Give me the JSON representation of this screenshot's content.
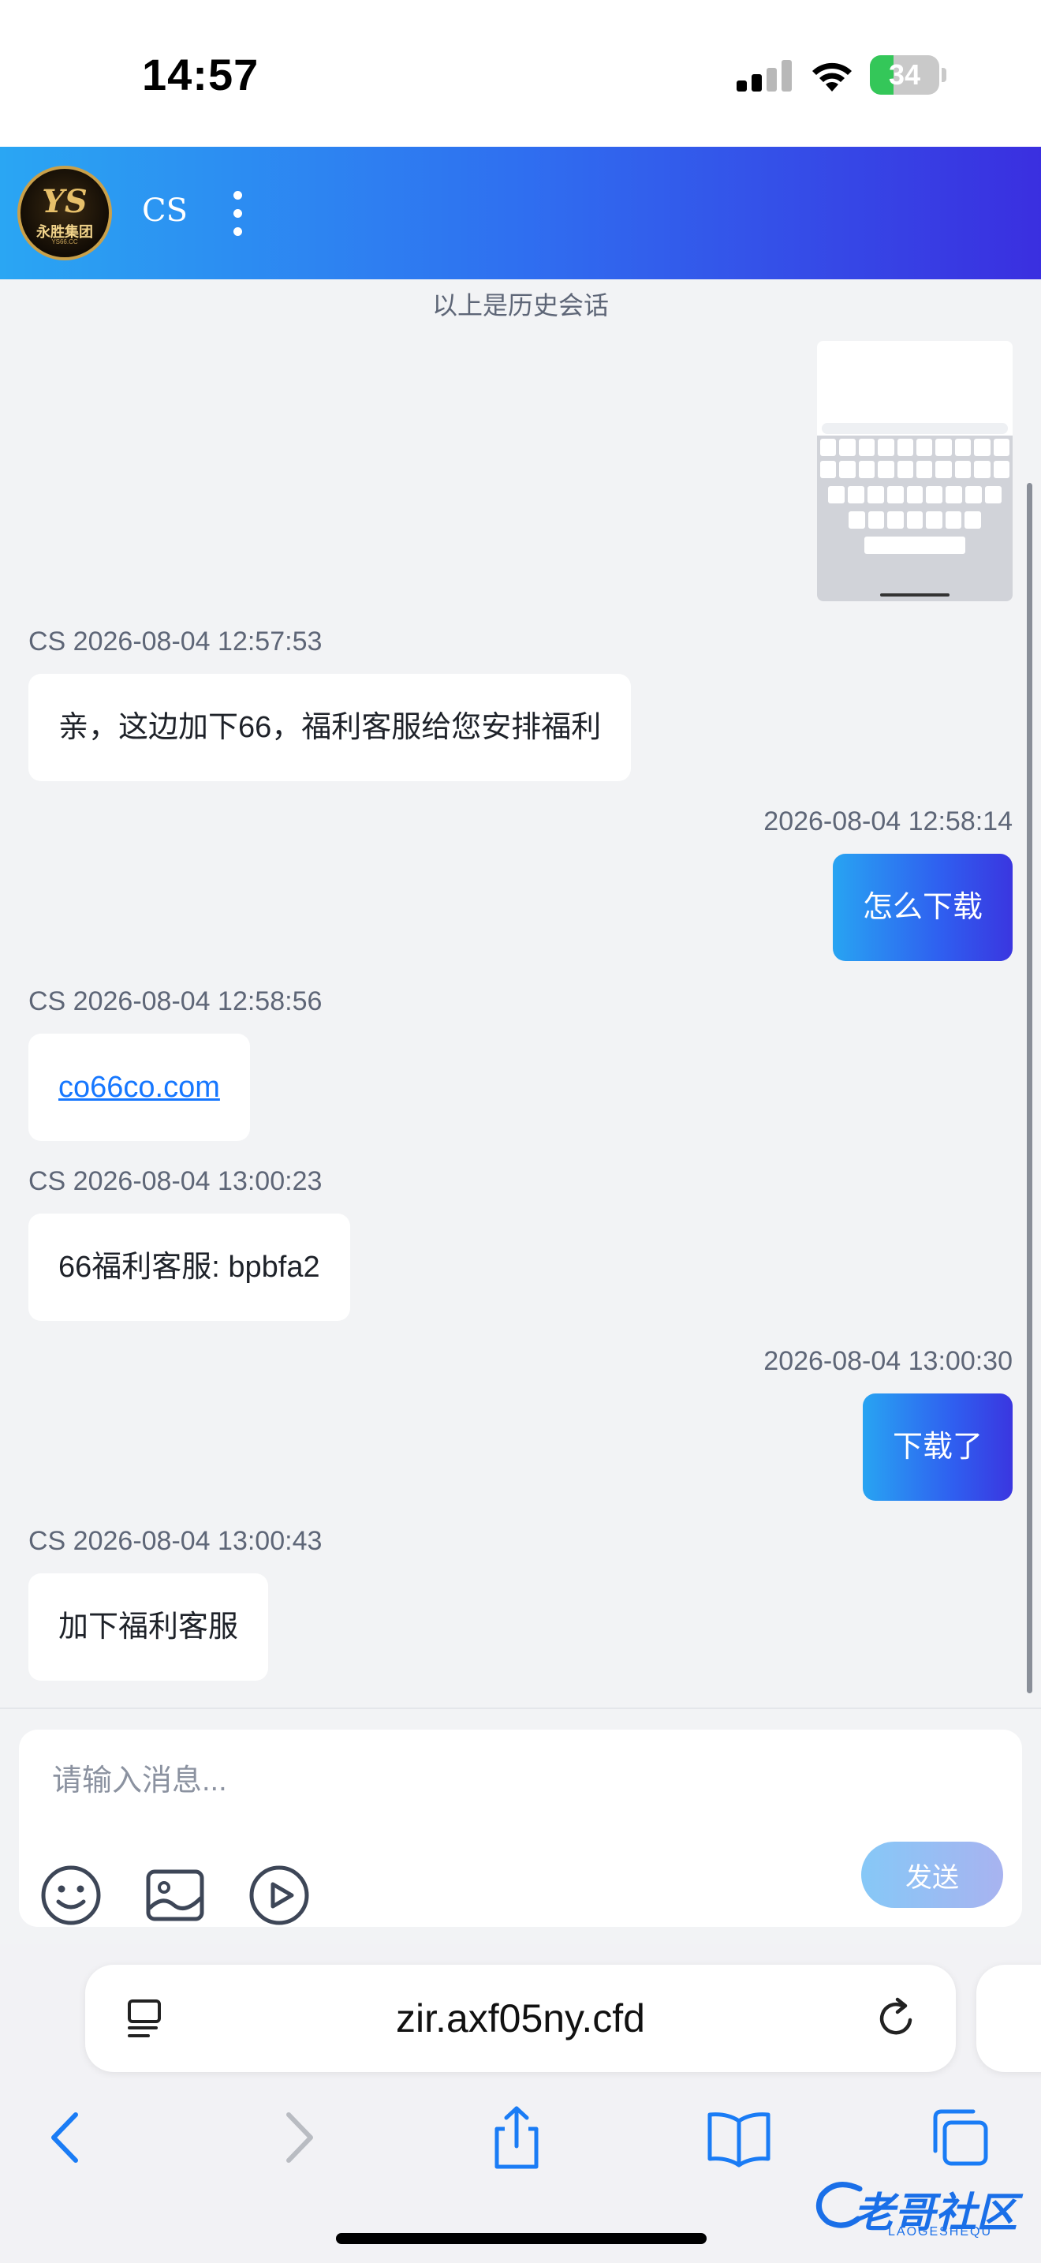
{
  "status_bar": {
    "time": "14:57",
    "battery_level": 34,
    "battery_text": "34"
  },
  "header": {
    "logo_mark": "YS",
    "logo_text": "永胜集团",
    "logo_sub": "YS66.CC",
    "title": "CS"
  },
  "chat": {
    "history_note": "以上是历史会话",
    "messages": [
      {
        "sender": "CS",
        "meta": "CS 2026-08-04 12:57:53",
        "text": "亲，这边加下66，福利客服给您安排福利"
      },
      {
        "sender": "me",
        "meta": "2026-08-04 12:58:14",
        "text": "怎么下载"
      },
      {
        "sender": "CS",
        "meta": "CS 2026-08-04 12:58:56",
        "text": "co66co.com"
      },
      {
        "sender": "CS",
        "meta": "CS 2026-08-04 13:00:23",
        "text": "66福利客服: bpbfa2"
      },
      {
        "sender": "me",
        "meta": "2026-08-04 13:00:30",
        "text": "下载了"
      },
      {
        "sender": "CS",
        "meta": "CS 2026-08-04 13:00:43",
        "text": "加下福利客服"
      }
    ]
  },
  "composer": {
    "placeholder": "请输入消息...",
    "send_label": "发送",
    "tools": [
      "emoji-icon",
      "image-icon",
      "video-icon"
    ]
  },
  "browser": {
    "url": "zir.axf05ny.cfd"
  },
  "watermark": {
    "text": "老哥社区",
    "sub": "LAOGESHEQU"
  },
  "colors": {
    "header_start": "#2aa6f3",
    "header_end": "#3a2fe0",
    "bubble_me_start": "#28a4f2",
    "bubble_me_end": "#3a36e0",
    "link": "#1677ff",
    "battery": "#34c759"
  }
}
